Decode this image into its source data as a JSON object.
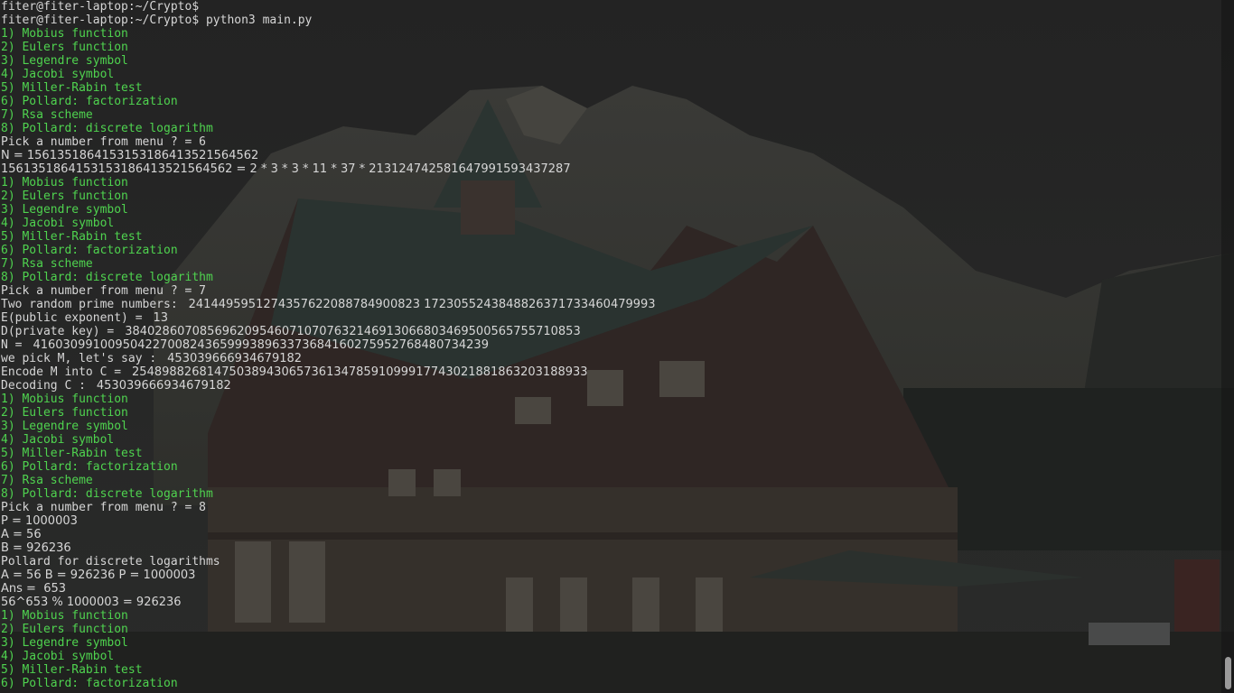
{
  "prompt": "fiter@fiter-laptop:~/Crypto$",
  "command_line": "fiter@fiter-laptop:~/Crypto$ python3 main.py",
  "menu": [
    "1) Mobius function",
    "2) Eulers function",
    "3) Legendre symbol",
    "4) Jacobi symbol",
    "5) Miller-Rabin test",
    "6) Pollard: factorization",
    "7) Rsa scheme",
    "8) Pollard: discrete logarithm"
  ],
  "session1": {
    "pick": "Pick a number from menu ? = 6",
    "n": "N = 1561351864153153186413521564562",
    "factorization": "1561351864153153186413521564562 = 2 * 3 * 3 * 11 * 37 * 213124742581647991593437287"
  },
  "session2": {
    "pick": "Pick a number from menu ? = 7",
    "primes_label": "Two random prime numbers: ",
    "primes_value": " 2414495951274357622088784900823 1723055243848826371733460479993",
    "e_label": "E(public exponent) = ",
    "e_value": " 13",
    "d_label": "D(private key) = ",
    "d_value": " 3840286070856962095460710707632146913066803469500565755710853",
    "n_label": "N = ",
    "n_value": " 4160309910095042270082436599938963373684160275952768480734239",
    "m_label": "we pick M, let's say : ",
    "m_value": " 453039666934679182",
    "c_label": "Encode M into C = ",
    "c_value": " 2548988268147503894306573613478591099917743021881863203188933",
    "dec_label": "Decoding C : ",
    "dec_value": " 453039666934679182"
  },
  "session3": {
    "pick": "Pick a number from menu ? = 8",
    "p": "P = 1000003",
    "a": "A = 56",
    "b": "B = 926236",
    "title": "Pollard for discrete logarithms",
    "params": "A = 56 B = 926236 P = 1000003",
    "ans": "Ans =  653",
    "check": "56^653 % 1000003 = 926236"
  },
  "colors": {
    "menu_green": "#4fd34f",
    "text_gray": "#d6d6d6",
    "background": "#1b1c1c"
  }
}
